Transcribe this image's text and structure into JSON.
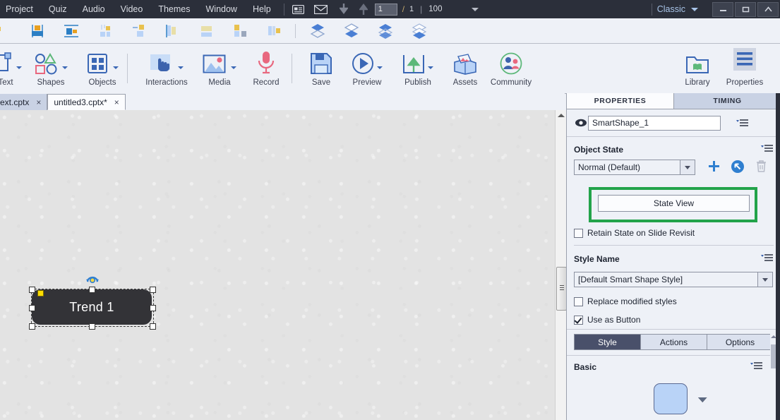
{
  "menu": {
    "items": [
      "Project",
      "Quiz",
      "Audio",
      "Video",
      "Themes",
      "Window",
      "Help"
    ],
    "icons": [
      "slide-notes-icon",
      "email-icon",
      "download-arrow-icon",
      "upload-arrow-icon"
    ],
    "page_current": "1",
    "page_separator": "/",
    "page_total": "1",
    "divider": "|",
    "zoom_value": "100",
    "zoom_caret": "chevron-down-icon",
    "workspace": "Classic",
    "window_buttons": [
      "minimize",
      "restore",
      "close"
    ]
  },
  "align_toolbar": {
    "tools": [
      "align-left-icon",
      "align-center-horizontal-icon",
      "align-middle-vertical-icon",
      "align-top-icon",
      "align-right-icon",
      "align-bottom-icon",
      "distribute-horizontal-icon",
      "distribute-vertical-icon",
      "resize-match-icon"
    ],
    "arrange": [
      "bring-to-front-icon",
      "send-to-back-icon",
      "bring-forward-icon",
      "send-backward-icon"
    ]
  },
  "toolbar": {
    "items": [
      {
        "label": "Text",
        "icon": "text-caption-icon",
        "has_dropdown": true
      },
      {
        "label": "Shapes",
        "icon": "shapes-icon",
        "has_dropdown": true
      },
      {
        "label": "Objects",
        "icon": "objects-grid-icon",
        "has_dropdown": true
      },
      {
        "label": "Interactions",
        "icon": "interactions-hand-icon",
        "has_dropdown": true
      },
      {
        "label": "Media",
        "icon": "media-image-icon",
        "has_dropdown": true
      },
      {
        "label": "Record",
        "icon": "record-microphone-icon",
        "has_dropdown": false
      },
      {
        "label": "Save",
        "icon": "save-floppy-icon",
        "has_dropdown": false
      },
      {
        "label": "Preview",
        "icon": "preview-play-icon",
        "has_dropdown": true
      },
      {
        "label": "Publish",
        "icon": "publish-upload-icon",
        "has_dropdown": true
      },
      {
        "label": "Assets",
        "icon": "assets-box-icon",
        "has_dropdown": false
      },
      {
        "label": "Community",
        "icon": "community-people-icon",
        "has_dropdown": false
      },
      {
        "label": "Library",
        "icon": "library-folder-icon",
        "has_dropdown": false
      },
      {
        "label": "Properties",
        "icon": "properties-lines-icon",
        "has_dropdown": false
      }
    ]
  },
  "doc_tabs": [
    {
      "label": "ext.cptx",
      "close": "×",
      "active": false
    },
    {
      "label": "untitled3.cptx*",
      "close": "×",
      "active": true
    }
  ],
  "canvas": {
    "shape_text": "Trend 1",
    "rotate_handle": "rotate-icon"
  },
  "properties": {
    "tabs": [
      {
        "label": "PROPERTIES",
        "active": true
      },
      {
        "label": "TIMING",
        "active": false
      }
    ],
    "visibility_icon": "eye-icon",
    "object_name": "SmartShape_1",
    "menu_icon": "hamburger-menu-icon",
    "object_state": {
      "title": "Object State",
      "selected": "Normal (Default)",
      "add_icon": "plus-icon",
      "reset_icon": "reset-circle-arrow-icon",
      "delete_icon": "trash-icon",
      "state_view_label": "State View",
      "retain_label": "Retain State on Slide Revisit",
      "retain_checked": false
    },
    "style_name": {
      "title": "Style Name",
      "selected": "[Default Smart Shape Style]",
      "replace_label": "Replace modified styles",
      "replace_checked": false,
      "button_label": "Use as Button",
      "button_checked": true
    },
    "segments": [
      {
        "label": "Style",
        "active": true
      },
      {
        "label": "Actions",
        "active": false
      },
      {
        "label": "Options",
        "active": false
      }
    ],
    "basic": {
      "title": "Basic",
      "shape_swatch_color": "#b9d3f7"
    }
  },
  "colors": {
    "menubar_bg": "#2b2f3a",
    "panel_bg": "#eef1f7",
    "canvas_bg": "#e3e3e3",
    "accent_blue": "#3a67b5",
    "highlight_green": "#22a34a",
    "shape_fill": "#333337",
    "active_tab_bg": "#49506a"
  }
}
